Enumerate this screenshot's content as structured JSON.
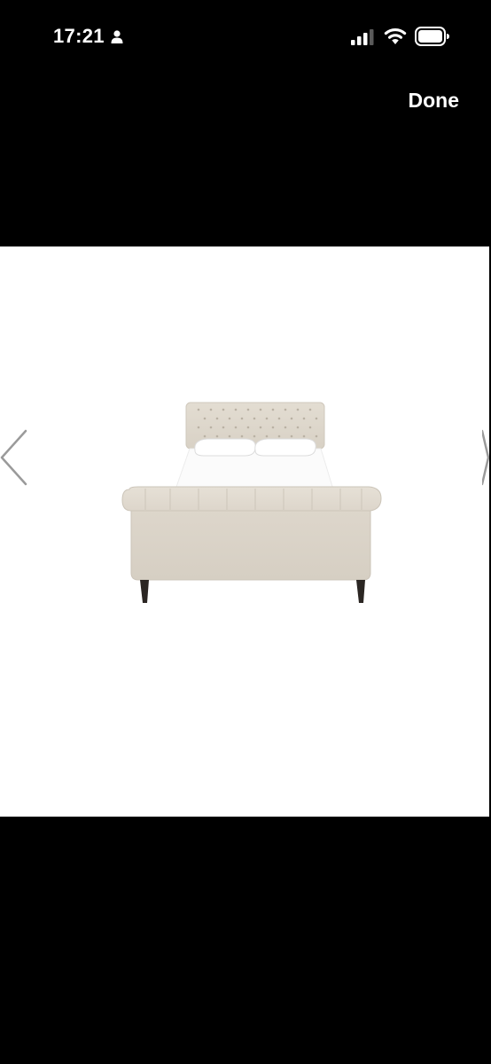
{
  "status_bar": {
    "time": "17:21",
    "icons": [
      "person-icon",
      "cellular-signal-icon",
      "wifi-icon",
      "battery-icon"
    ]
  },
  "header": {
    "done_label": "Done"
  },
  "viewer": {
    "navigation": {
      "prev_icon": "chevron-left-icon",
      "next_icon": "chevron-right-icon"
    }
  },
  "colors": {
    "background": "#000000",
    "viewer_background": "#ffffff",
    "text": "#ffffff",
    "arrow": "#9a9a9a",
    "upholstery": "#ddd6cb",
    "bedding": "#fbfbfb"
  }
}
